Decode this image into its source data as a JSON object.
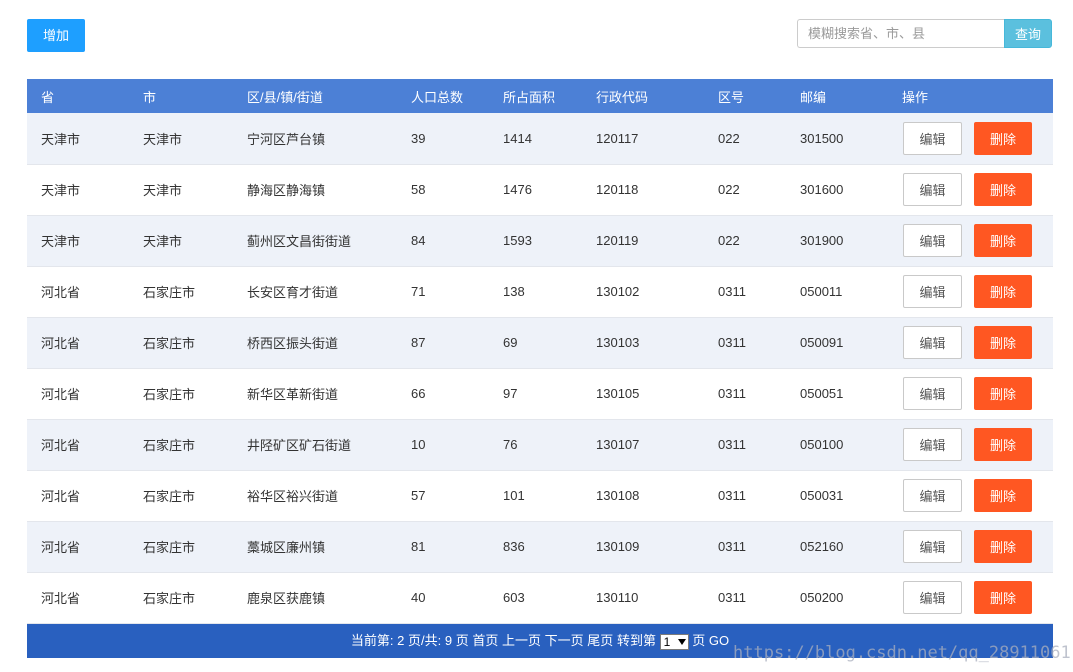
{
  "colors": {
    "primary": "#1e9fff",
    "search_button": "#5bc0de",
    "table_header": "#4c80d6",
    "row_stripe": "#eef2f9",
    "delete_button": "#ff5722",
    "footer": "#2960bf"
  },
  "toolbar": {
    "add_label": "增加",
    "search_placeholder": "模糊搜索省、市、县",
    "search_button_label": "查询"
  },
  "table": {
    "headers": [
      "省",
      "市",
      "区/县/镇/街道",
      "人口总数",
      "所占面积",
      "行政代码",
      "区号",
      "邮编",
      "操作"
    ],
    "edit_label": "编辑",
    "delete_label": "删除",
    "rows": [
      {
        "province": "天津市",
        "city": "天津市",
        "district": "宁河区芦台镇",
        "population": "39",
        "area": "1414",
        "admin_code": "120117",
        "area_code": "022",
        "postcode": "301500"
      },
      {
        "province": "天津市",
        "city": "天津市",
        "district": "静海区静海镇",
        "population": "58",
        "area": "1476",
        "admin_code": "120118",
        "area_code": "022",
        "postcode": "301600"
      },
      {
        "province": "天津市",
        "city": "天津市",
        "district": "蓟州区文昌街街道",
        "population": "84",
        "area": "1593",
        "admin_code": "120119",
        "area_code": "022",
        "postcode": "301900"
      },
      {
        "province": "河北省",
        "city": "石家庄市",
        "district": "长安区育才街道",
        "population": "71",
        "area": "138",
        "admin_code": "130102",
        "area_code": "0311",
        "postcode": "050011"
      },
      {
        "province": "河北省",
        "city": "石家庄市",
        "district": "桥西区振头街道",
        "population": "87",
        "area": "69",
        "admin_code": "130103",
        "area_code": "0311",
        "postcode": "050091"
      },
      {
        "province": "河北省",
        "city": "石家庄市",
        "district": "新华区革新街道",
        "population": "66",
        "area": "97",
        "admin_code": "130105",
        "area_code": "0311",
        "postcode": "050051"
      },
      {
        "province": "河北省",
        "city": "石家庄市",
        "district": "井陉矿区矿石街道",
        "population": "10",
        "area": "76",
        "admin_code": "130107",
        "area_code": "0311",
        "postcode": "050100"
      },
      {
        "province": "河北省",
        "city": "石家庄市",
        "district": "裕华区裕兴街道",
        "population": "57",
        "area": "101",
        "admin_code": "130108",
        "area_code": "0311",
        "postcode": "050031"
      },
      {
        "province": "河北省",
        "city": "石家庄市",
        "district": "藁城区廉州镇",
        "population": "81",
        "area": "836",
        "admin_code": "130109",
        "area_code": "0311",
        "postcode": "052160"
      },
      {
        "province": "河北省",
        "city": "石家庄市",
        "district": "鹿泉区获鹿镇",
        "population": "40",
        "area": "603",
        "admin_code": "130110",
        "area_code": "0311",
        "postcode": "050200"
      }
    ]
  },
  "pagination": {
    "current_label": "当前第:",
    "current_page": "2",
    "total_label": "页/共:",
    "total_pages": "9",
    "total_unit": "页",
    "first": "首页",
    "prev": "上一页",
    "next": "下一页",
    "last": "尾页",
    "goto_label": "转到第",
    "goto_value": "1",
    "goto_unit": "页",
    "go": "GO",
    "select_icon": "dropdown-arrow-icon"
  },
  "watermark": "https://blog.csdn.net/qq_28911061"
}
